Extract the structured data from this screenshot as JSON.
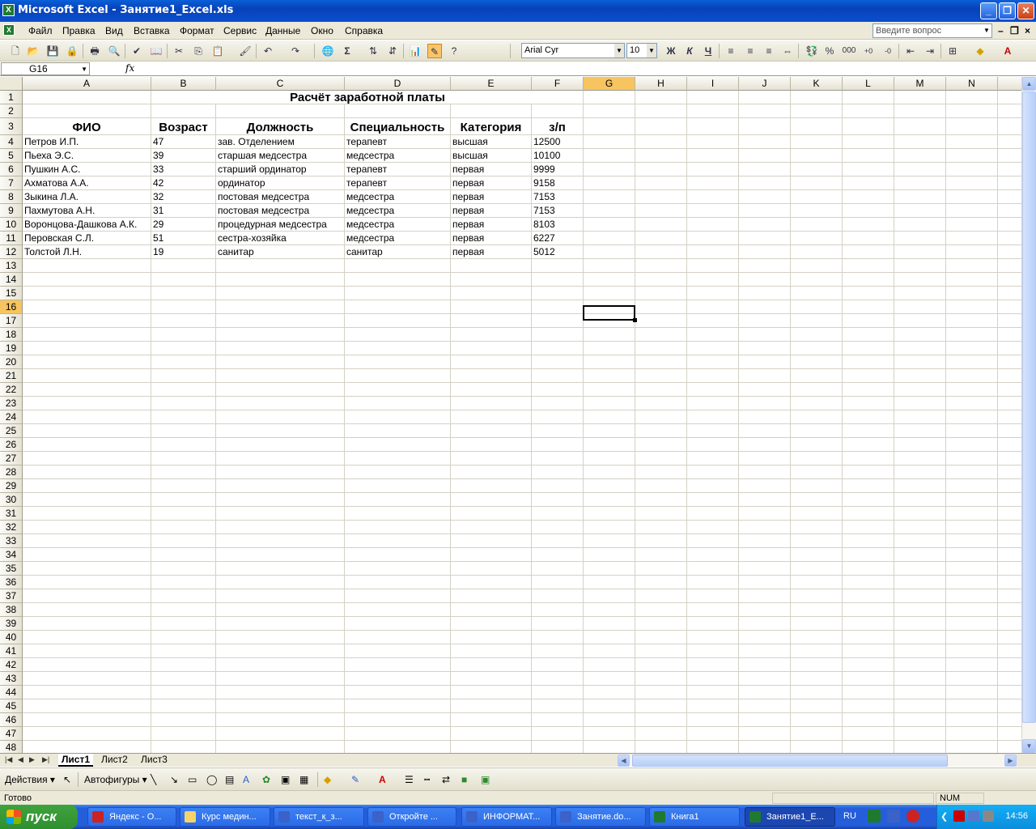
{
  "window": {
    "title": "Microsoft Excel - Занятие1_Excel.xls",
    "icon": "excel-icon",
    "min_label": "_",
    "max_label": "❐",
    "close_label": "✕"
  },
  "menu": {
    "items": [
      "Файл",
      "Правка",
      "Вид",
      "Вставка",
      "Формат",
      "Сервис",
      "Данные",
      "Окно",
      "Справка"
    ],
    "ask_placeholder": "Введите вопрос",
    "doc_min": "–",
    "doc_restore": "❐",
    "doc_close": "×"
  },
  "toolbar": {
    "font_name": "Arial Cyr",
    "font_size": "10",
    "bold": "Ж",
    "italic": "К",
    "underline": "Ч",
    "percent": "%",
    "thousands": "000",
    "sum": "Σ"
  },
  "formula_bar": {
    "name_box": "G16",
    "fx_label": "fx",
    "content": ""
  },
  "sheet": {
    "columns": [
      "A",
      "B",
      "C",
      "D",
      "E",
      "F",
      "G",
      "H",
      "I",
      "J",
      "K",
      "L",
      "M",
      "N"
    ],
    "selected_column": "G",
    "selected_row": "16",
    "title": "Расчёт заработной платы",
    "headers": [
      "ФИО",
      "Возраст",
      "Должность",
      "Специальность",
      "Категория",
      "з/п"
    ],
    "rows": [
      [
        "Петров И.П.",
        "47",
        "зав. Отделением",
        "терапевт",
        "высшая",
        "12500"
      ],
      [
        "Пьеха Э.С.",
        "39",
        "старшая медсестра",
        "медсестра",
        "высшая",
        "10100"
      ],
      [
        "Пушкин А.С.",
        "33",
        "старший ординатор",
        "терапевт",
        "первая",
        "9999"
      ],
      [
        "Ахматова А.А.",
        "42",
        "ординатор",
        "терапевт",
        "первая",
        "9158"
      ],
      [
        "Зыкина Л.А.",
        "32",
        "постовая медсестра",
        "медсестра",
        "первая",
        "7153"
      ],
      [
        "Пахмутова А.Н.",
        "31",
        "постовая медсестра",
        "медсестра",
        "первая",
        "7153"
      ],
      [
        "Воронцова-Дашкова А.К.",
        "29",
        "процедурная медсестра",
        "медсестра",
        "первая",
        "8103"
      ],
      [
        "Перовская С.Л.",
        "51",
        "сестра-хозяйка",
        "медсестра",
        "первая",
        "6227"
      ],
      [
        "Толстой Л.Н.",
        "19",
        "санитар",
        "санитар",
        "первая",
        "5012"
      ]
    ],
    "row_numbers": [
      "1",
      "2",
      "3",
      "4",
      "5",
      "6",
      "7",
      "8",
      "9",
      "10",
      "11",
      "12",
      "13",
      "14",
      "15",
      "16",
      "17",
      "18",
      "19",
      "20",
      "21",
      "22",
      "23",
      "24",
      "25",
      "26",
      "27",
      "28",
      "29",
      "30",
      "31",
      "32",
      "33",
      "34",
      "35",
      "36",
      "37",
      "38",
      "39",
      "40",
      "41",
      "42",
      "43",
      "44",
      "45",
      "46",
      "47",
      "48"
    ]
  },
  "sheet_tabs": [
    "Лист1",
    "Лист2",
    "Лист3"
  ],
  "active_tab": "Лист1",
  "draw_toolbar": {
    "actions": "Действия ▾",
    "autoshapes": "Автофигуры ▾"
  },
  "status": {
    "ready": "Готово",
    "num": "NUM"
  },
  "taskbar": {
    "start": "пуск",
    "tasks": [
      "Яндекс - О...",
      "Курс медин...",
      "текст_к_з...",
      "Откройте ...",
      "ИНФОРМАТ...",
      "Занятие.do...",
      "Книга1",
      "Занятие1_E..."
    ],
    "active_task": "Занятие1_E...",
    "language": "RU",
    "clock": "14:56"
  },
  "colors": {
    "title_bar": "#0842b8",
    "chrome": "#ece9d8",
    "selection_header": "#f7c45f",
    "taskbar": "#245edb",
    "start_button": "#3ea33e"
  }
}
